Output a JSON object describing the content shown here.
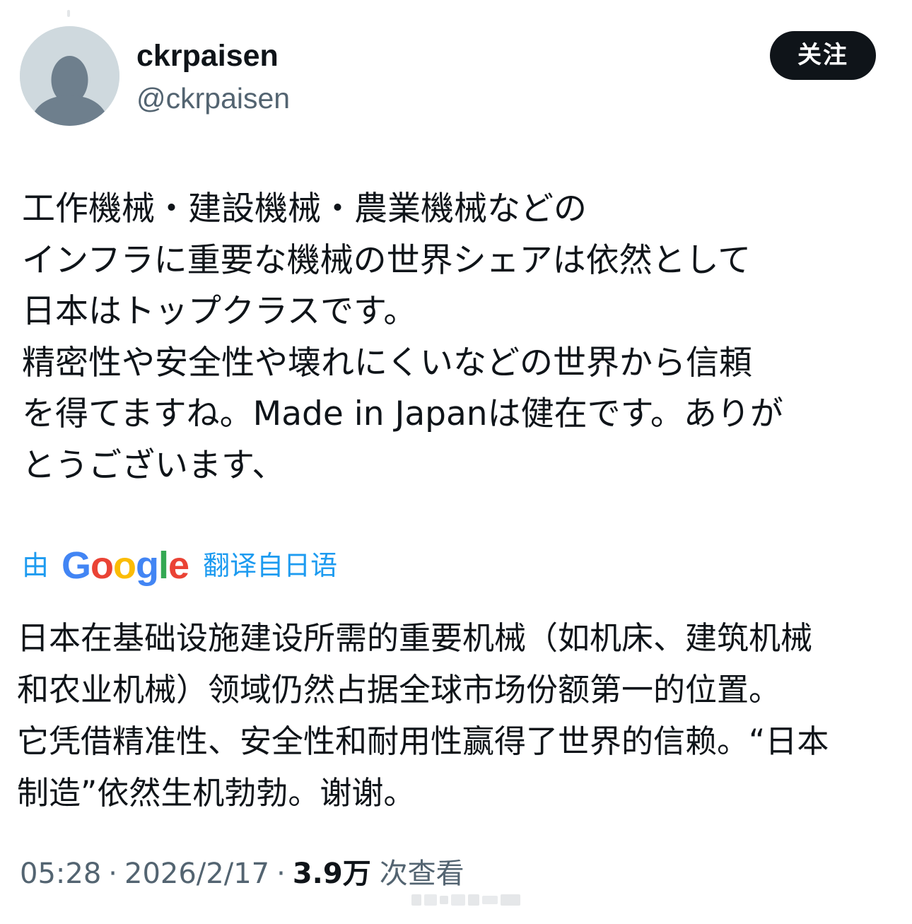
{
  "user": {
    "display_name": "ckrpaisen",
    "handle": "@ckrpaisen",
    "avatar_icon": "default-avatar-icon"
  },
  "follow_button": {
    "label": "关注"
  },
  "post": {
    "original_lines": [
      "工作機械・建設機械・農業機械などの",
      "インフラに重要な機械の世界シェアは依然として",
      "日本はトップクラスです。",
      "精密性や安全性や壊れにくいなどの世界から信頼",
      "を得てますね。Made in Japanは健在です。ありが",
      "とうございます、"
    ],
    "translation_label": {
      "prefix": "由",
      "provider": "Google",
      "suffix": "翻译自日语"
    },
    "translated_lines": [
      "日本在基础设施建设所需的重要机械（如机床、建筑机械",
      "和农业机械）领域仍然占据全球市场份额第一的位置。",
      "它凭借精准性、安全性和耐用性赢得了世界的信赖。“日本",
      "制造”依然生机勃勃。谢谢。"
    ]
  },
  "meta": {
    "time": "05:28",
    "separator": "·",
    "date": "2026/2/17",
    "views_count": "3.9万",
    "views_label": "次查看"
  },
  "colors": {
    "text_primary": "#0f1419",
    "text_secondary": "#536471",
    "link_blue": "#1d9bf0",
    "avatar_bg": "#cfd9de",
    "avatar_figure": "#6e7f8d",
    "button_bg": "#0f1419"
  }
}
